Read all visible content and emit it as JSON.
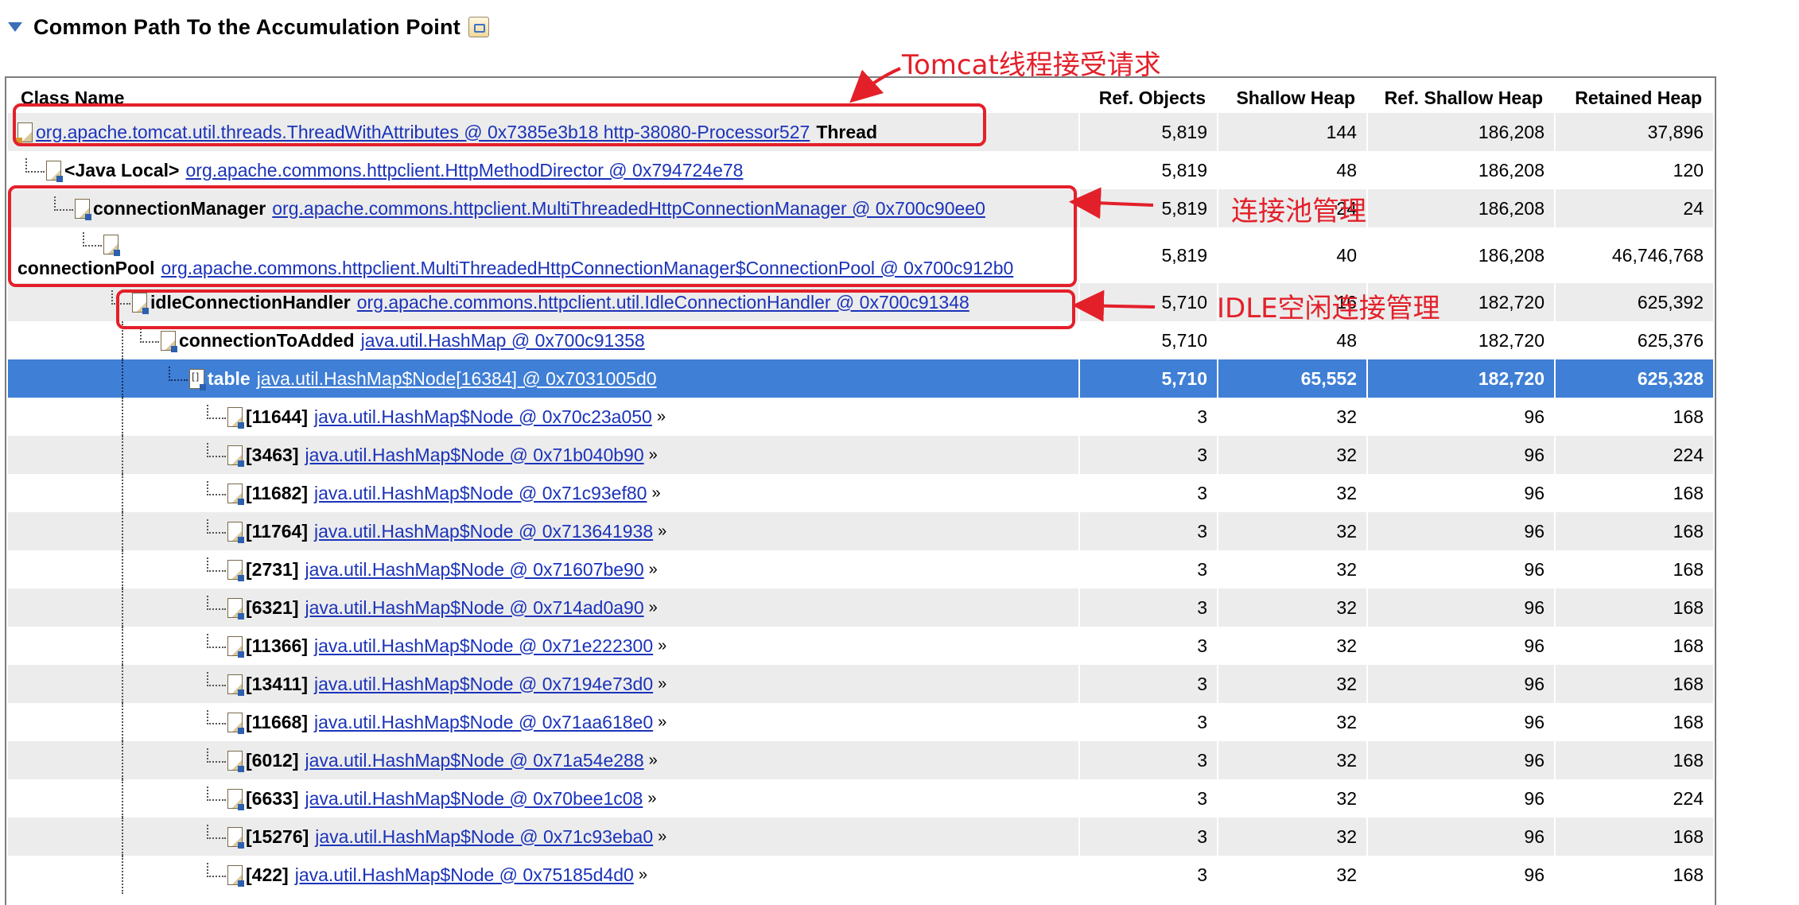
{
  "section": {
    "title": "Common Path To the Accumulation Point"
  },
  "columns": {
    "class_name": "Class Name",
    "ref_objects": "Ref. Objects",
    "shallow_heap": "Shallow Heap",
    "ref_shallow_heap": "Ref. Shallow Heap",
    "retained_heap": "Retained Heap"
  },
  "rows": [
    {
      "label": "",
      "link": "org.apache.tomcat.util.threads.ThreadWithAttributes @ 0x7385e3b18 http-38080-Processor527",
      "suffix": "Thread",
      "ref_objects": "5,819",
      "shallow_heap": "144",
      "ref_shallow_heap": "186,208",
      "retained_heap": "37,896"
    },
    {
      "label": "<Java Local>",
      "link": "org.apache.commons.httpclient.HttpMethodDirector @ 0x794724e78",
      "ref_objects": "5,819",
      "shallow_heap": "48",
      "ref_shallow_heap": "186,208",
      "retained_heap": "120"
    },
    {
      "label": "connectionManager",
      "link": "org.apache.commons.httpclient.MultiThreadedHttpConnectionManager @ 0x700c90ee0",
      "ref_objects": "5,819",
      "shallow_heap": "24",
      "ref_shallow_heap": "186,208",
      "retained_heap": "24"
    },
    {
      "label": "connectionPool",
      "link": "org.apache.commons.httpclient.MultiThreadedHttpConnectionManager$ConnectionPool @ 0x700c912b0",
      "ref_objects": "5,819",
      "shallow_heap": "40",
      "ref_shallow_heap": "186,208",
      "retained_heap": "46,746,768"
    },
    {
      "label": "idleConnectionHandler",
      "link": "org.apache.commons.httpclient.util.IdleConnectionHandler @ 0x700c91348",
      "ref_objects": "5,710",
      "shallow_heap": "16",
      "ref_shallow_heap": "182,720",
      "retained_heap": "625,392"
    },
    {
      "label": "connectionToAdded",
      "link": "java.util.HashMap @ 0x700c91358",
      "ref_objects": "5,710",
      "shallow_heap": "48",
      "ref_shallow_heap": "182,720",
      "retained_heap": "625,376"
    },
    {
      "label": "table",
      "link": "java.util.HashMap$Node[16384] @ 0x7031005d0",
      "ref_objects": "5,710",
      "shallow_heap": "65,552",
      "ref_shallow_heap": "182,720",
      "retained_heap": "625,328"
    },
    {
      "label": "[11644]",
      "link": "java.util.HashMap$Node @ 0x70c23a050",
      "more": "»",
      "ref_objects": "3",
      "shallow_heap": "32",
      "ref_shallow_heap": "96",
      "retained_heap": "168"
    },
    {
      "label": "[3463]",
      "link": "java.util.HashMap$Node @ 0x71b040b90",
      "more": "»",
      "ref_objects": "3",
      "shallow_heap": "32",
      "ref_shallow_heap": "96",
      "retained_heap": "224"
    },
    {
      "label": "[11682]",
      "link": "java.util.HashMap$Node @ 0x71c93ef80",
      "more": "»",
      "ref_objects": "3",
      "shallow_heap": "32",
      "ref_shallow_heap": "96",
      "retained_heap": "168"
    },
    {
      "label": "[11764]",
      "link": "java.util.HashMap$Node @ 0x713641938",
      "more": "»",
      "ref_objects": "3",
      "shallow_heap": "32",
      "ref_shallow_heap": "96",
      "retained_heap": "168"
    },
    {
      "label": "[2731]",
      "link": "java.util.HashMap$Node @ 0x71607be90",
      "more": "»",
      "ref_objects": "3",
      "shallow_heap": "32",
      "ref_shallow_heap": "96",
      "retained_heap": "168"
    },
    {
      "label": "[6321]",
      "link": "java.util.HashMap$Node @ 0x714ad0a90",
      "more": "»",
      "ref_objects": "3",
      "shallow_heap": "32",
      "ref_shallow_heap": "96",
      "retained_heap": "168"
    },
    {
      "label": "[11366]",
      "link": "java.util.HashMap$Node @ 0x71e222300",
      "more": "»",
      "ref_objects": "3",
      "shallow_heap": "32",
      "ref_shallow_heap": "96",
      "retained_heap": "168"
    },
    {
      "label": "[13411]",
      "link": "java.util.HashMap$Node @ 0x7194e73d0",
      "more": "»",
      "ref_objects": "3",
      "shallow_heap": "32",
      "ref_shallow_heap": "96",
      "retained_heap": "168"
    },
    {
      "label": "[11668]",
      "link": "java.util.HashMap$Node @ 0x71aa618e0",
      "more": "»",
      "ref_objects": "3",
      "shallow_heap": "32",
      "ref_shallow_heap": "96",
      "retained_heap": "168"
    },
    {
      "label": "[6012]",
      "link": "java.util.HashMap$Node @ 0x71a54e288",
      "more": "»",
      "ref_objects": "3",
      "shallow_heap": "32",
      "ref_shallow_heap": "96",
      "retained_heap": "168"
    },
    {
      "label": "[6633]",
      "link": "java.util.HashMap$Node @ 0x70bee1c08",
      "more": "»",
      "ref_objects": "3",
      "shallow_heap": "32",
      "ref_shallow_heap": "96",
      "retained_heap": "224"
    },
    {
      "label": "[15276]",
      "link": "java.util.HashMap$Node @ 0x71c93eba0",
      "more": "»",
      "ref_objects": "3",
      "shallow_heap": "32",
      "ref_shallow_heap": "96",
      "retained_heap": "168"
    },
    {
      "label": "[422]",
      "link": "java.util.HashMap$Node @ 0x75185d4d0",
      "more": "»",
      "ref_objects": "3",
      "shallow_heap": "32",
      "ref_shallow_heap": "96",
      "retained_heap": "168"
    }
  ],
  "annotations": {
    "tomcat": "Tomcat线程接受请求",
    "pool": "连接池管理",
    "idle": "IDLE空闲连接管理",
    "color": "#e3202a"
  },
  "colors": {
    "selection": "#3f7fd6",
    "link": "#1b33b9",
    "alt_row": "#ececec"
  }
}
